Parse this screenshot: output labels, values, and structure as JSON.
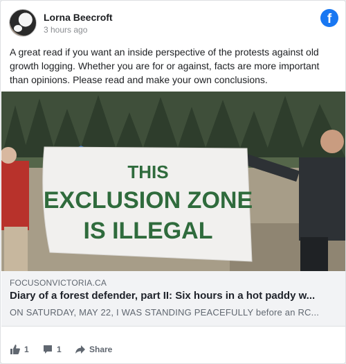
{
  "post": {
    "author": "Lorna Beecroft",
    "time": "3 hours ago",
    "text": "A great read if you want an inside perspective of the protests against old growth logging. Whether you are for or against, facts are more important than opinions. Please read and make your own conclusions."
  },
  "platform": {
    "icon": "facebook-icon",
    "brand_color": "#1877f2",
    "icon_letter": "f"
  },
  "photo": {
    "banner_lines": [
      "THIS",
      "EXCLUSION ZONE",
      "IS ILLEGAL"
    ],
    "banner_text_color": "#2f6b3c"
  },
  "link": {
    "domain": "FOCUSONVICTORIA.CA",
    "title": "Diary of a forest defender, part II: Six hours in a hot paddy w...",
    "description": "ON SATURDAY, MAY 22, I WAS STANDING PEACEFULLY before an RC..."
  },
  "actions": {
    "likes": "1",
    "comments": "1",
    "share_label": "Share"
  },
  "colors": {
    "secondary_text": "#606770",
    "link_bg": "#f2f3f5"
  }
}
